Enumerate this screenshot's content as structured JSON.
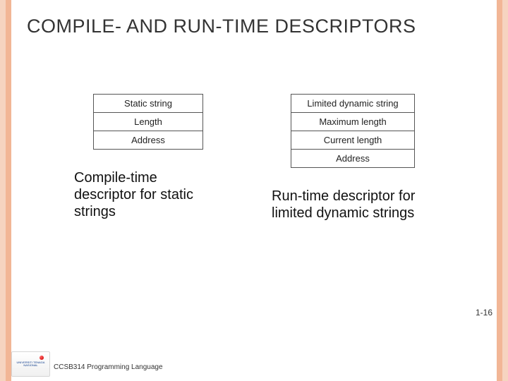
{
  "title": "COMPILE- AND RUN-TIME DESCRIPTORS",
  "left_table": {
    "rows": [
      "Static string",
      "Length",
      "Address"
    ]
  },
  "right_table": {
    "rows": [
      "Limited dynamic string",
      "Maximum length",
      "Current length",
      "Address"
    ]
  },
  "left_caption": "Compile-time descriptor for static strings",
  "right_caption": "Run-time descriptor for limited dynamic strings",
  "footer": "CCSB314 Programming Language",
  "slide_number": "1-16",
  "logo_text": "UNIVERSITI TENAGA NASIONAL"
}
